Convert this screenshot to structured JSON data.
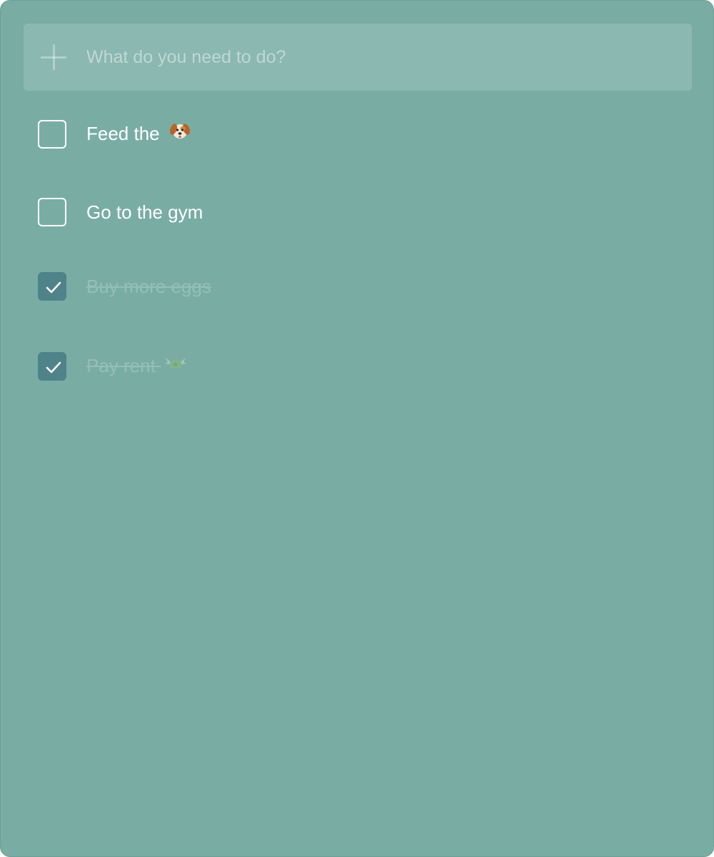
{
  "new_todo": {
    "placeholder": "What do you need to do?",
    "value": ""
  },
  "todos": [
    {
      "label": "Feed the",
      "emoji_icon": "dog-face-icon",
      "done": false
    },
    {
      "label": "Go to the gym",
      "done": false
    },
    {
      "label": "Buy more eggs",
      "done": true
    },
    {
      "label": "Pay rent",
      "emoji_icon": "money-with-wings-icon",
      "done": true
    }
  ],
  "colors": {
    "background": "#79ada4",
    "checked_box": "#4f838a",
    "done_text": "#94bfb8"
  }
}
